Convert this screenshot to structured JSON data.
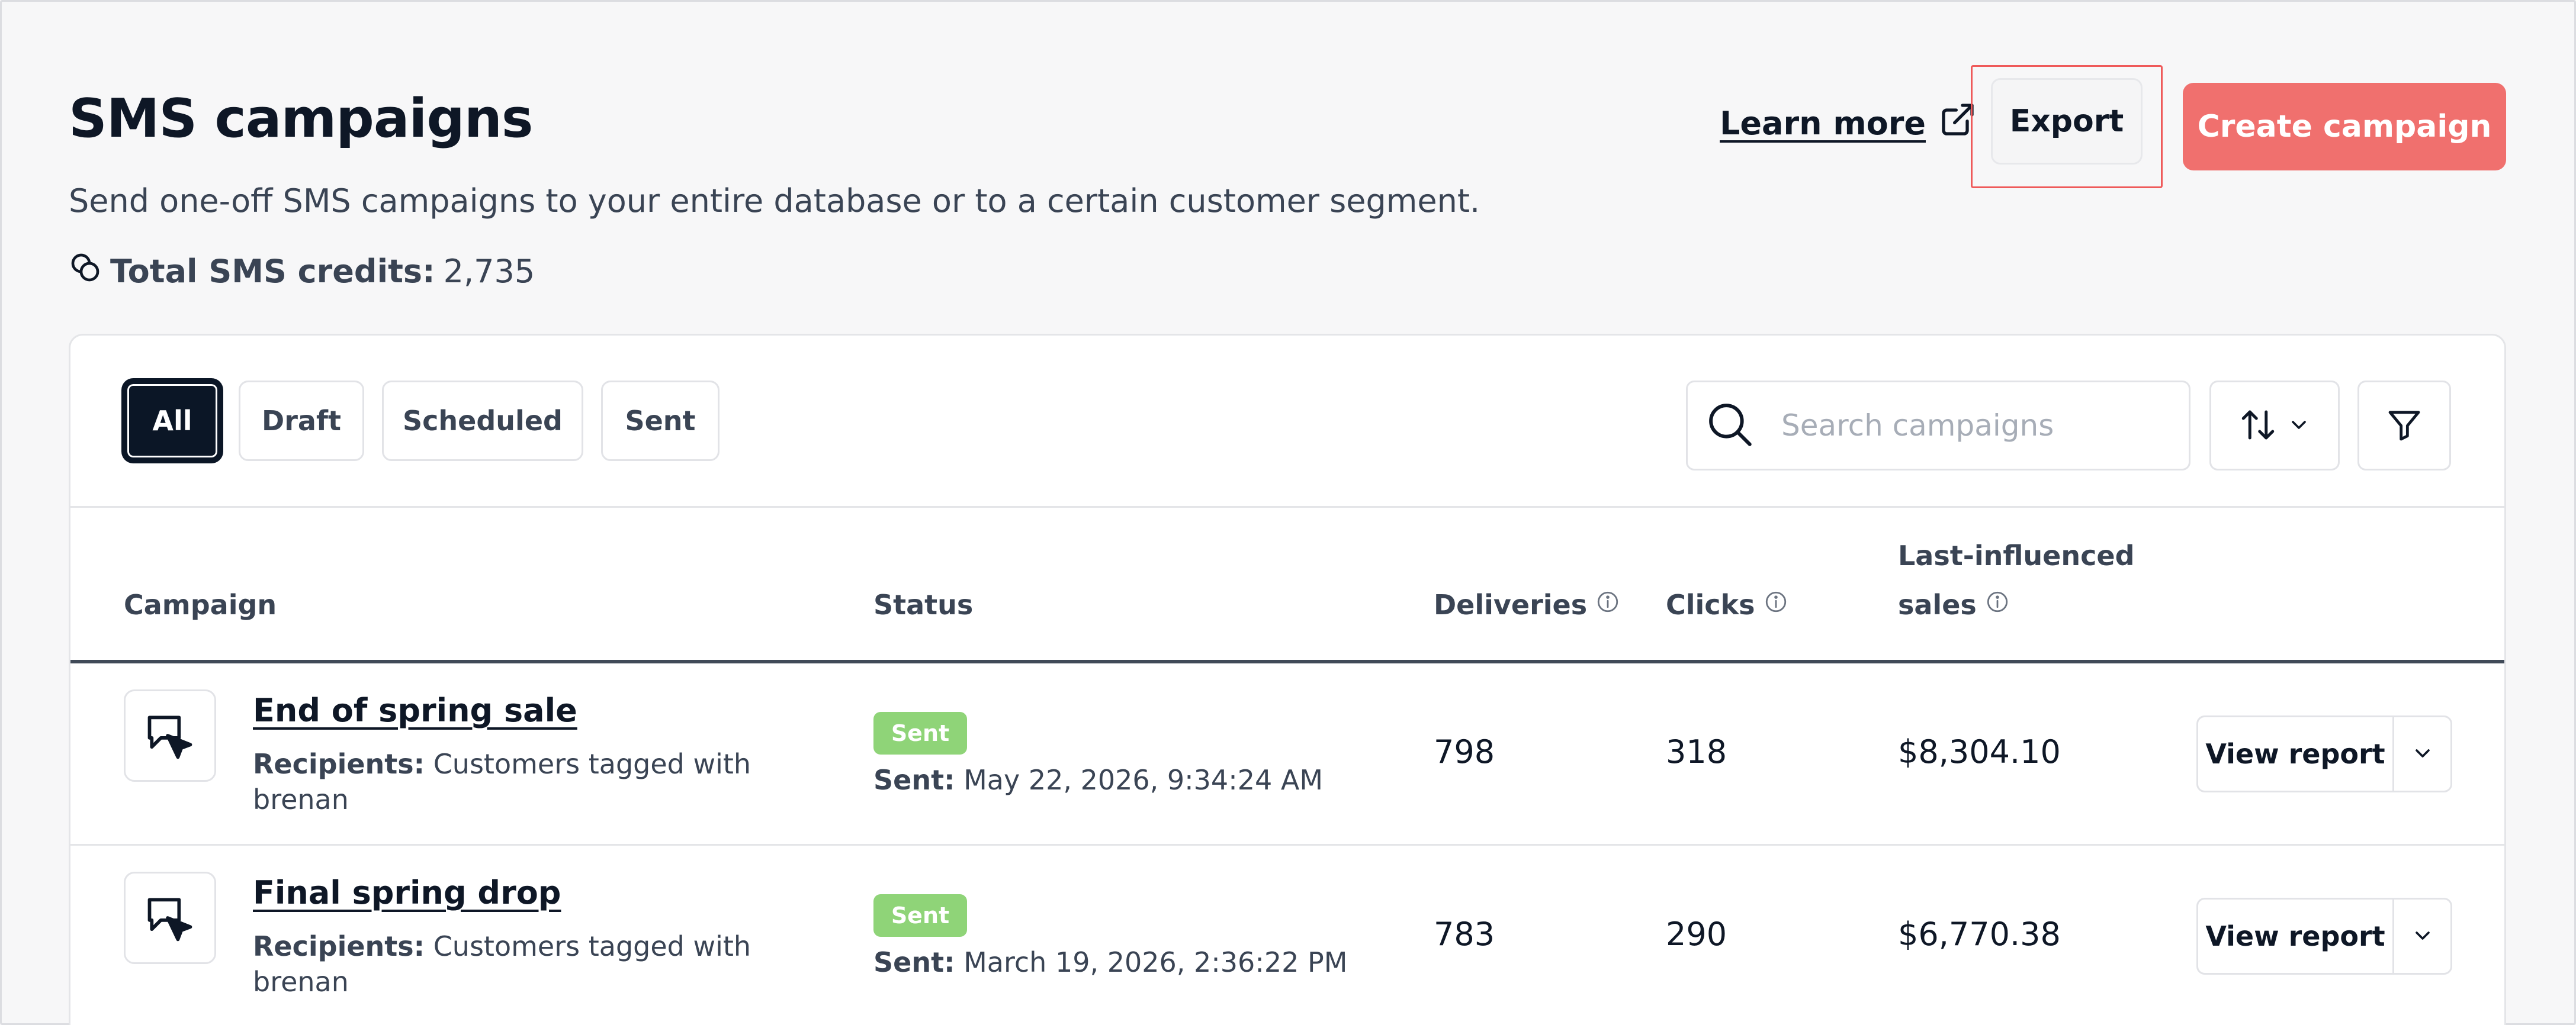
{
  "header": {
    "title": "SMS campaigns",
    "subtitle": "Send one-off SMS campaigns to your entire database or to a certain customer segment.",
    "credits_label": "Total SMS credits:",
    "credits_value": "2,735",
    "learn_more": "Learn more",
    "export_label": "Export",
    "create_label": "Create campaign"
  },
  "tabs": [
    {
      "label": "All",
      "active": true
    },
    {
      "label": "Draft",
      "active": false
    },
    {
      "label": "Scheduled",
      "active": false
    },
    {
      "label": "Sent",
      "active": false
    }
  ],
  "search": {
    "placeholder": "Search campaigns",
    "value": ""
  },
  "columns": {
    "campaign": "Campaign",
    "status": "Status",
    "deliveries": "Deliveries",
    "clicks": "Clicks",
    "sales_line1": "Last-influenced",
    "sales_line2": "sales"
  },
  "rows": [
    {
      "title": "End of spring sale",
      "recipients_label": "Recipients:",
      "recipients_value": "Customers tagged with brenan",
      "status": "Sent",
      "sent_label": "Sent:",
      "sent_date": "May 22, 2026, 9:34:24 AM",
      "deliveries": "798",
      "clicks": "318",
      "sales": "$8,304.10",
      "action": "View report"
    },
    {
      "title": "Final spring drop",
      "recipients_label": "Recipients:",
      "recipients_value": "Customers tagged with brenan",
      "status": "Sent",
      "sent_label": "Sent:",
      "sent_date": "March 19, 2026, 2:36:22 PM",
      "deliveries": "783",
      "clicks": "290",
      "sales": "$6,770.38",
      "action": "View report"
    }
  ],
  "colors": {
    "primary": "#f0706e",
    "dark": "#0b1626",
    "sent_badge": "#8fd478",
    "highlight": "#ef5a5a"
  }
}
